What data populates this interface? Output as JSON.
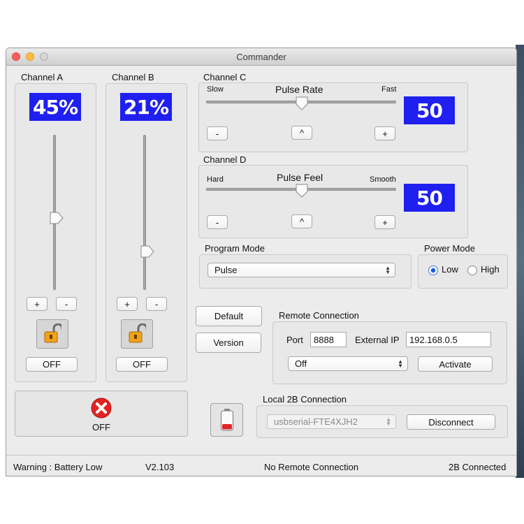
{
  "window": {
    "title": "Commander"
  },
  "channel_a": {
    "label": "Channel A",
    "level_display": "45%",
    "level_fraction": 0.45,
    "plus_label": "+",
    "minus_label": "-",
    "lock_icon": "unlocked-padlock-icon",
    "toggle_label": "OFF"
  },
  "channel_b": {
    "label": "Channel B",
    "level_display": "21%",
    "level_fraction": 0.21,
    "plus_label": "+",
    "minus_label": "-",
    "lock_icon": "unlocked-padlock-icon",
    "toggle_label": "OFF"
  },
  "channel_c": {
    "label": "Channel C",
    "slider_title": "Pulse Rate",
    "min_label": "Slow",
    "max_label": "Fast",
    "value": "50",
    "minus_label": "-",
    "center_label": "^",
    "plus_label": "+"
  },
  "channel_d": {
    "label": "Channel D",
    "slider_title": "Pulse Feel",
    "min_label": "Hard",
    "max_label": "Smooth",
    "value": "50",
    "minus_label": "-",
    "center_label": "^",
    "plus_label": "+"
  },
  "program_mode": {
    "label": "Program Mode",
    "selected": "Pulse"
  },
  "power_mode": {
    "label": "Power Mode",
    "options": [
      "Low",
      "High"
    ],
    "selected": "Low"
  },
  "buttons": {
    "default_label": "Default",
    "version_label": "Version"
  },
  "remote": {
    "label": "Remote Connection",
    "port_label": "Port",
    "port_value": "8888",
    "ip_label": "External IP",
    "ip_value": "192.168.0.5",
    "mode_selected": "Off",
    "activate_label": "Activate"
  },
  "master": {
    "stop_icon": "red-x-stop-icon",
    "label": "OFF"
  },
  "battery": {
    "icon": "battery-low-icon"
  },
  "local": {
    "label": "Local 2B Connection",
    "device_selected": "usbserial-FTE4XJH2",
    "disconnect_label": "Disconnect"
  },
  "status": {
    "warning": "Warning : Battery Low",
    "version": "V2.103",
    "remote_status": "No Remote Connection",
    "device_status": "2B Connected"
  },
  "colors": {
    "readout_bg": "#1f1ff0",
    "accent_blue": "#1a5fe0",
    "stop_red": "#e02424"
  }
}
